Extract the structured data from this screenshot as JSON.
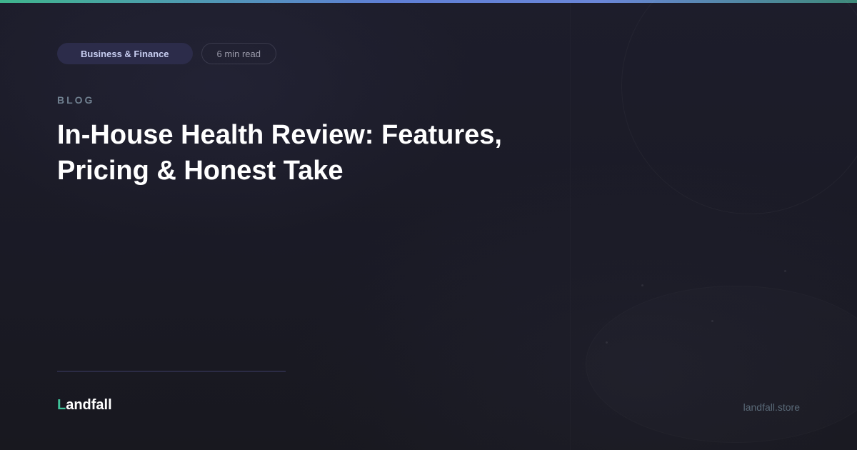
{
  "category": "Business & Finance",
  "read_time": "6 min read",
  "eyebrow": "BLOG",
  "title": "In-House Health Review: Features, Pricing & Honest Take",
  "brand": {
    "initial": "L",
    "rest": "andfall"
  },
  "domain": "landfall.store",
  "colors": {
    "accent": "#3fc39a",
    "background": "#1b1b27",
    "category_pill": "#2c2c4a"
  }
}
